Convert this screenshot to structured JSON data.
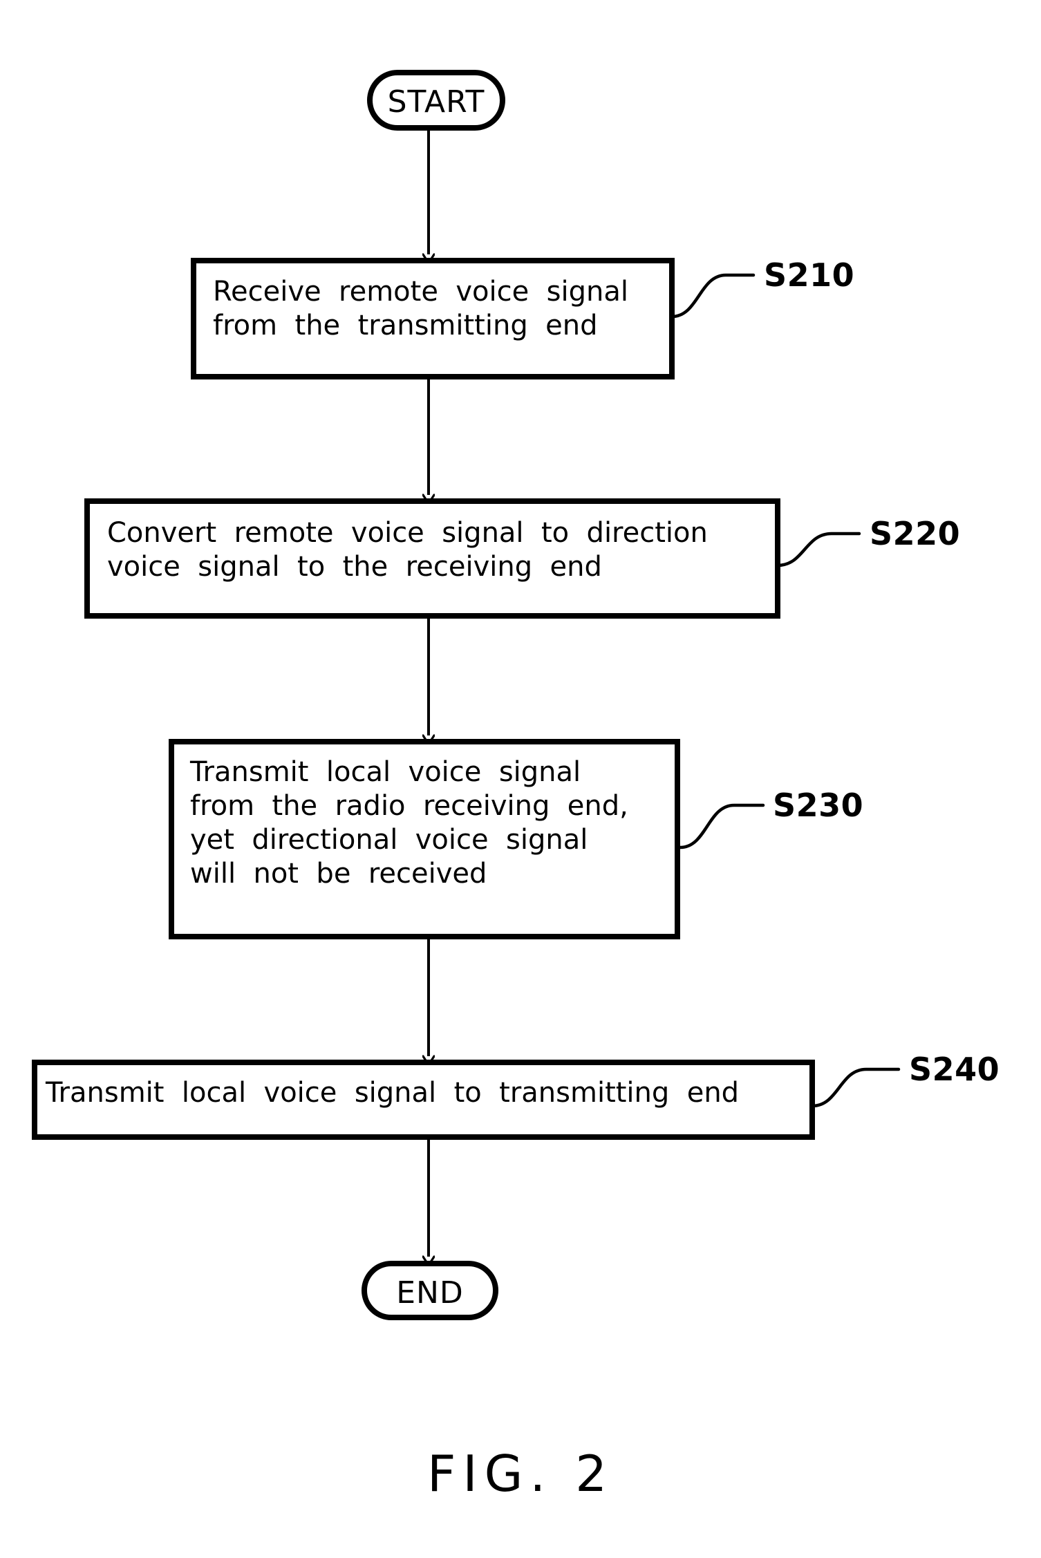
{
  "figure": {
    "caption": "FIG. 2",
    "colors": {
      "stroke": "#000000",
      "background": "#ffffff",
      "text": "#000000"
    }
  },
  "flowchart": {
    "type": "flowchart",
    "orientation": "top-to-bottom",
    "start_node": {
      "label": "START",
      "shape": "stadium"
    },
    "end_node": {
      "label": "END",
      "shape": "stadium"
    },
    "steps": [
      {
        "ref": "S210",
        "shape": "rectangle",
        "lines": [
          "Receive  remote  voice  signal",
          "from  the  transmitting  end"
        ]
      },
      {
        "ref": "S220",
        "shape": "rectangle",
        "lines": [
          "Convert  remote  voice  signal  to  direction",
          "voice  signal  to  the  receiving  end"
        ]
      },
      {
        "ref": "S230",
        "shape": "rectangle",
        "lines": [
          "Transmit  local  voice  signal",
          "from  the  radio  receiving  end,",
          "yet  directional  voice  signal",
          "will  not  be  received"
        ]
      },
      {
        "ref": "S240",
        "shape": "rectangle",
        "lines": [
          "Transmit  local  voice  signal  to  transmitting  end"
        ]
      }
    ],
    "connectors": [
      {
        "from": "START",
        "to": "S210",
        "arrow": true
      },
      {
        "from": "S210",
        "to": "S220",
        "arrow": true
      },
      {
        "from": "S220",
        "to": "S230",
        "arrow": true
      },
      {
        "from": "S230",
        "to": "S240",
        "arrow": true
      },
      {
        "from": "S240",
        "to": "END",
        "arrow": true
      }
    ]
  }
}
